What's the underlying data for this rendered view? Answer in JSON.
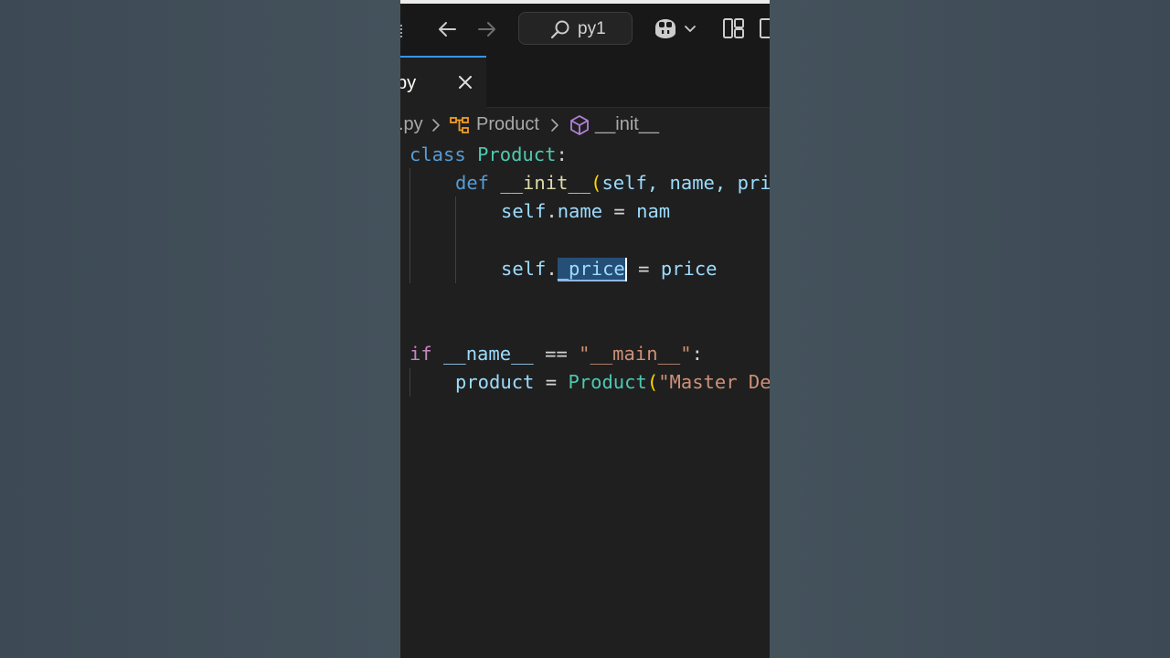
{
  "titlebar": {
    "search_text": "py1",
    "icons": [
      "arrow-left-icon",
      "arrow-right-icon",
      "search-icon",
      "copilot-icon",
      "chevron-down-icon",
      "layout-icon",
      "panel-icon"
    ]
  },
  "tab": {
    "label": "py",
    "close_glyph": "✕"
  },
  "breadcrumb": {
    "file": ".py",
    "class": "Product",
    "method": "__init__"
  },
  "code": {
    "l1_kw": "class",
    "l1_name": "Product",
    "l1_colon": ":",
    "l2_kw": "def",
    "l2_fn": "__init__",
    "l2_open": "(",
    "l2_params": "self, name, pri",
    "l3_self": "self",
    "l3_dot": ".",
    "l3_attr": "name",
    "l3_eq": " = ",
    "l3_val": "nam",
    "l4_self": "self",
    "l4_dot": ".",
    "l4_attr": "_price",
    "l4_eq": " = ",
    "l4_val": "price",
    "l5_kw": "if",
    "l5_name": "__name__",
    "l5_eq": " == ",
    "l5_str": "\"__main__\"",
    "l5_colon": ":",
    "l6_var": "product",
    "l6_eq": " = ",
    "l6_cls": "Product",
    "l6_open": "(",
    "l6_str": "\"Master De"
  }
}
